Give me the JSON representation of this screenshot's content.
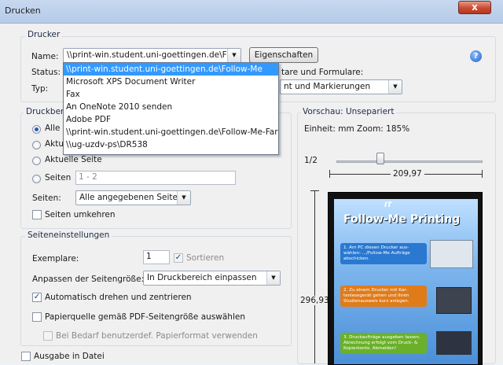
{
  "window": {
    "title": "Drucken",
    "close_glyph": "x"
  },
  "printer": {
    "group_label": "Drucker",
    "name_label": "Name:",
    "name_value": "\\\\print-win.student.uni-goettingen.de\\Foll",
    "properties_button": "Eigenschaften",
    "status_label": "Status:",
    "type_label": "Typ:",
    "comments_label": "tare und Formulare:",
    "comments_value": "nt und Markierungen",
    "dropdown_items": [
      "\\\\print-win.student.uni-goettingen.de\\Follow-Me",
      "Microsoft XPS Document Writer",
      "Fax",
      "An OneNote 2010 senden",
      "Adobe PDF",
      "\\\\print-win.student.uni-goettingen.de\\Follow-Me-Farbe",
      "\\\\ug-uzdv-ps\\DR538"
    ],
    "selected_index": 0
  },
  "range": {
    "group_label": "Druckbere",
    "all_label": "Alle",
    "current_label": "Aktue",
    "current_page_label": "Aktuelle Seite",
    "pages_label": "Seiten",
    "pages_value": "1 - 2",
    "subset_label": "Seiten:",
    "subset_value": "Alle angegebenen Seiten",
    "reverse_label": "Seiten umkehren"
  },
  "page_setup": {
    "group_label": "Seiteneinstellungen",
    "copies_label": "Exemplare:",
    "copies_value": "1",
    "collate_label": "Sortieren",
    "fit_label": "Anpassen der Seitengröße:",
    "fit_value": "In Druckbereich einpassen",
    "autorotate_label": "Automatisch drehen und zentrieren",
    "autorotate_checked": true,
    "paper_source_label": "Papierquelle gemäß PDF-Seitengröße auswählen",
    "custom_paper_label": "Bei Bedarf benutzerdef. Papierformat verwenden",
    "output_file_label": "Ausgabe in Datei"
  },
  "preview": {
    "group_label": "Vorschau: Unsepariert",
    "units_label": "Einheit: mm Zoom: 185%",
    "page_counter": "1/2",
    "width_label": "209,97",
    "height_label": "296,93",
    "poster_logo": "IT",
    "poster_title": "Follow-Me Printing",
    "poster_step1": "1. Am PC diesen Drucker aus-wählen: .../Follow-Me Aufträge abschicken.",
    "poster_step2": "2. Zu einem Drucker mit Kar-tenlesegerät gehen und Ihren Studienausweis kurz anlegen.",
    "poster_step3": "3. Druckaufträge ausgeben lassen. Abrechnung erfolgt vom Druck- & Kopierkonto. Abmelden!"
  },
  "help_glyph": "?"
}
